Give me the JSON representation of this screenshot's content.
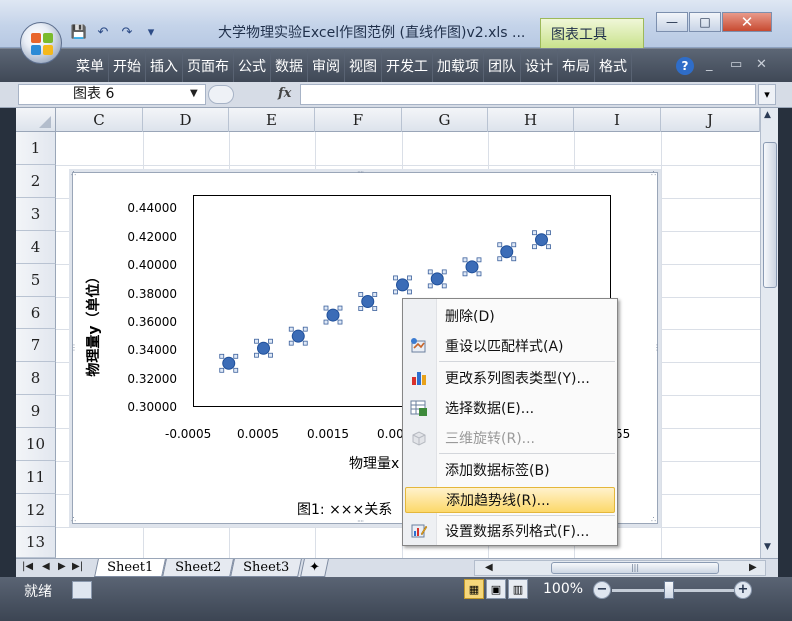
{
  "window": {
    "doc_title": "大学物理实验Excel作图范例 (直线作图)v2.xls  ...",
    "context_tab": "图表工具",
    "minimize": "—",
    "restore": "□",
    "close": "✕"
  },
  "qat": {
    "save": "💾",
    "undo": "↶",
    "redo": "↷",
    "customize": "▾"
  },
  "ribbon": {
    "tabs": [
      "菜单",
      "开始",
      "插入",
      "页面布",
      "公式",
      "数据",
      "审阅",
      "视图",
      "开发工",
      "加载项",
      "团队",
      "设计",
      "布局",
      "格式"
    ],
    "help": "?",
    "minimize": "_",
    "restore": "▭",
    "close": "✕"
  },
  "formula_bar": {
    "name_box": "图表 6",
    "fx": "fx",
    "formula": ""
  },
  "grid": {
    "columns": [
      "C",
      "D",
      "E",
      "F",
      "G",
      "H",
      "I",
      "J"
    ],
    "rows": [
      "1",
      "2",
      "3",
      "4",
      "5",
      "6",
      "7",
      "8",
      "9",
      "10",
      "11",
      "12",
      "13"
    ]
  },
  "chart_data": {
    "type": "scatter",
    "ylabel": "物理量y（单位）",
    "xlabel": "物理量x",
    "caption": "图1:  ×××关系",
    "xlim": [
      -0.0005,
      0.0055
    ],
    "ylim": [
      0.3,
      0.44
    ],
    "y_ticks": [
      "0.44000",
      "0.42000",
      "0.40000",
      "0.38000",
      "0.36000",
      "0.34000",
      "0.32000",
      "0.30000"
    ],
    "x_ticks": [
      "-0.0005",
      "0.0005",
      "0.0015",
      "0.00",
      "55"
    ],
    "series": [
      {
        "x": [
          0.0,
          0.0005,
          0.001,
          0.0015,
          0.002,
          0.0025,
          0.003,
          0.0035,
          0.004,
          0.0045
        ],
        "y": [
          0.329,
          0.339,
          0.347,
          0.361,
          0.37,
          0.381,
          0.385,
          0.393,
          0.403,
          0.411
        ],
        "color": "#3b6cb7"
      }
    ]
  },
  "context_menu": {
    "items": [
      {
        "label": "删除(D)",
        "icon": "none",
        "disabled": false
      },
      {
        "label": "重设以匹配样式(A)",
        "icon": "reset-style-icon",
        "disabled": false
      },
      {
        "label": "更改系列图表类型(Y)...",
        "icon": "chart-type-icon",
        "disabled": false
      },
      {
        "label": "选择数据(E)...",
        "icon": "select-data-icon",
        "disabled": false
      },
      {
        "label": "三维旋转(R)...",
        "icon": "rotate-3d-icon",
        "disabled": true
      },
      {
        "label": "添加数据标签(B)",
        "icon": "none",
        "disabled": false
      },
      {
        "label": "添加趋势线(R)...",
        "icon": "none",
        "disabled": false,
        "highlighted": true
      },
      {
        "label": "设置数据系列格式(F)...",
        "icon": "format-series-icon",
        "disabled": false
      }
    ]
  },
  "sheets": {
    "tabs": [
      "Sheet1",
      "Sheet2",
      "Sheet3"
    ],
    "active": "Sheet1"
  },
  "status": {
    "text": "就绪",
    "zoom": "100%",
    "zoom_minus": "−",
    "zoom_plus": "+"
  }
}
